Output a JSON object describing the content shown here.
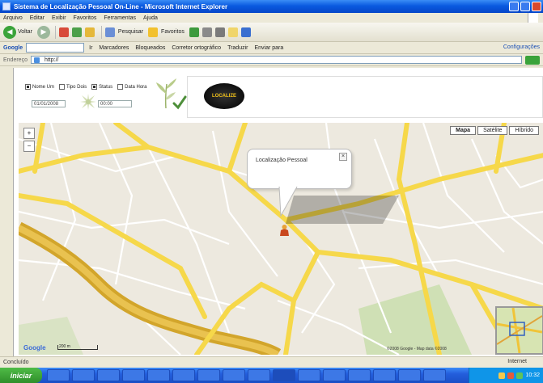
{
  "window": {
    "title": "Sistema de Localização Pessoal On-Line - Microsoft Internet Explorer"
  },
  "menu": [
    "Arquivo",
    "Editar",
    "Exibir",
    "Favoritos",
    "Ferramentas",
    "Ajuda"
  ],
  "toolbar": {
    "back_label": "Voltar",
    "search_label": "Pesquisar",
    "favorites_label": "Favoritos"
  },
  "linkbar": {
    "google_label": "Google",
    "items": [
      "Ir",
      "Marcadores",
      "Bloqueados",
      "Corretor ortográfico",
      "Traduzir",
      "Enviar para"
    ],
    "right_label": "Configurações"
  },
  "address": {
    "label": "Endereço",
    "value": "http://"
  },
  "form": {
    "checkboxes": [
      {
        "label": "Nome Um",
        "checked": true
      },
      {
        "label": "Tipo Dois",
        "checked": false
      },
      {
        "label": "Status",
        "checked": true
      },
      {
        "label": "Data Hora",
        "checked": false
      }
    ],
    "date_from": "01/01/2008",
    "date_to": "00:00"
  },
  "logo": {
    "text": "LOCALIZE"
  },
  "map": {
    "types": [
      "Mapa",
      "Satélite",
      "Híbrido"
    ],
    "active_type": "Mapa",
    "info_title": "Localização Pessoal",
    "close_symbol": "×",
    "zoom_in": "+",
    "zoom_out": "−",
    "google_logo": "Google",
    "scale_label": "200 m",
    "copyright": "©2008 Google - Map data ©2008"
  },
  "status": {
    "text": "Concluído",
    "zone": "Internet"
  },
  "taskbar": {
    "start_label": "iniciar",
    "task_count": 16,
    "active_task": 9,
    "clock": "10:32"
  },
  "colors": {
    "road_major": "#f6d84a",
    "road_minor": "#ffffff",
    "river": "#d2a52b",
    "map_bg": "#ede9df"
  }
}
